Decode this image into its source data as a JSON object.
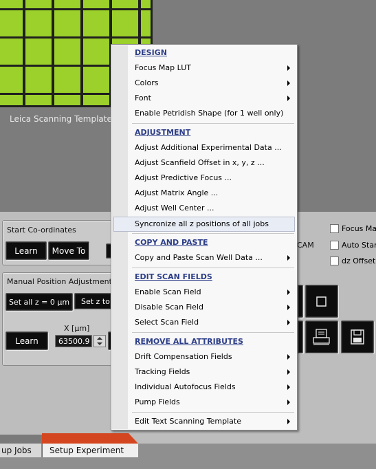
{
  "template": {
    "label": "Leica Scanning Template"
  },
  "start_coordinates": {
    "title": "Start Co-ordinates",
    "learn_label": "Learn",
    "move_to_label": "Move To",
    "cam_partial": "CAM"
  },
  "options": {
    "focus_map_label": "Focus Map",
    "auto_start_label": "Auto Start",
    "dz_offset_label": "dz Offset"
  },
  "manual_adjustment": {
    "title": "Manual Position Adjustment",
    "set_all_z_label": "Set all  z = 0 µm",
    "set_z_partial_label": "Set z to a",
    "x_label": "X [µm]",
    "x_value": "63500.9",
    "learn_label": "Learn"
  },
  "tabs": [
    {
      "label": "up Jobs"
    },
    {
      "label": "Setup Experiment"
    }
  ],
  "context_menu": {
    "sections": [
      {
        "header": "DESIGN",
        "items": [
          {
            "label": "Focus Map LUT",
            "submenu": true
          },
          {
            "label": "Colors",
            "submenu": true
          },
          {
            "label": "Font",
            "submenu": true
          },
          {
            "label": "Enable Petridish Shape (for 1 well only)",
            "submenu": false
          }
        ]
      },
      {
        "header": "ADJUSTMENT",
        "items": [
          {
            "label": "Adjust Additional Experimental Data ...",
            "submenu": false
          },
          {
            "label": "Adjust Scanfield Offset in x, y, z ...",
            "submenu": false
          },
          {
            "label": "Adjust Predictive Focus ...",
            "submenu": false
          },
          {
            "label": "Adjust Matrix Angle ...",
            "submenu": false
          },
          {
            "label": "Adjust Well Center ...",
            "submenu": false
          },
          {
            "label": "Syncronize all z positions of all jobs",
            "submenu": false,
            "highlighted": true
          }
        ]
      },
      {
        "header": "COPY AND PASTE",
        "items": [
          {
            "label": "Copy and Paste Scan Well  Data ...",
            "submenu": true
          }
        ]
      },
      {
        "header": "EDIT SCAN FIELDS",
        "items": [
          {
            "label": "Enable Scan Field",
            "submenu": true
          },
          {
            "label": "Disable Scan Field",
            "submenu": true
          },
          {
            "label": "Select Scan Field",
            "submenu": true
          }
        ]
      },
      {
        "header": "REMOVE ALL ATTRIBUTES",
        "items": [
          {
            "label": "Drift Compensation Fields",
            "submenu": true
          },
          {
            "label": "Tracking Fields",
            "submenu": true
          },
          {
            "label": "Individual Autofocus Fields",
            "submenu": true
          },
          {
            "label": "Pump Fields",
            "submenu": true
          }
        ]
      },
      {
        "header": "",
        "items": [
          {
            "label": "Edit Text Scanning Template",
            "submenu": true
          }
        ]
      }
    ]
  },
  "colors": {
    "well_green": "#9bd12a",
    "menu_header": "#2d3e88",
    "tab_accent": "#d4461f"
  },
  "icons": [
    "stop-icon",
    "printer-icon",
    "save-icon",
    "submenu-arrow-icon",
    "spinner-up-icon",
    "spinner-down-icon"
  ]
}
